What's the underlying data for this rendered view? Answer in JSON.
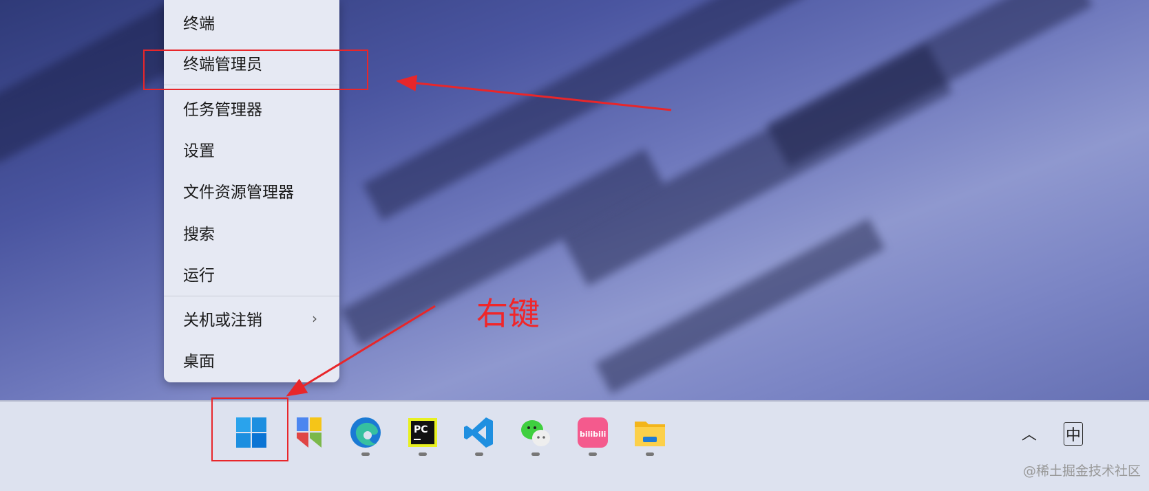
{
  "context_menu": {
    "items": [
      {
        "label": "终端"
      },
      {
        "label": "终端管理员"
      },
      {
        "label": "任务管理器"
      },
      {
        "label": "设置"
      },
      {
        "label": "文件资源管理器"
      },
      {
        "label": "搜索"
      },
      {
        "label": "运行"
      },
      {
        "label": "关机或注销",
        "has_submenu": true
      },
      {
        "label": "桌面"
      }
    ]
  },
  "annotation": {
    "text": "右键",
    "color": "#e8262a"
  },
  "taskbar": {
    "apps": [
      {
        "name": "start"
      },
      {
        "name": "bookmark-app"
      },
      {
        "name": "edge"
      },
      {
        "name": "pycharm",
        "label": "PC"
      },
      {
        "name": "vscode"
      },
      {
        "name": "wechat"
      },
      {
        "name": "bilibili",
        "label": "bilibili"
      },
      {
        "name": "file-explorer"
      }
    ],
    "tray_ime": "中"
  },
  "watermark": "@稀土掘金技术社区"
}
